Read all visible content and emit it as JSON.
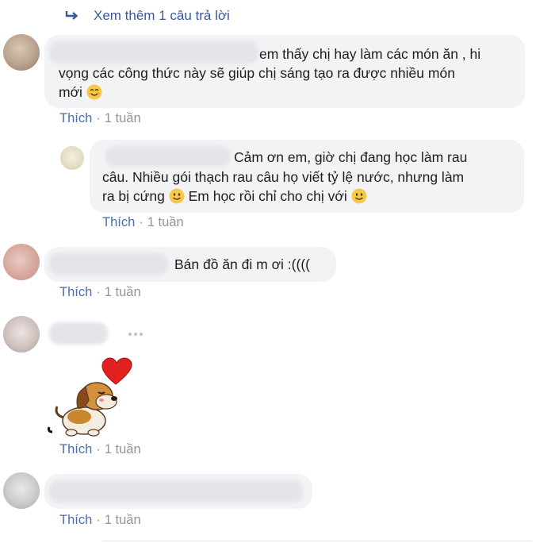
{
  "more_replies": {
    "label": "Xem thêm 1 câu trả lời"
  },
  "comments": [
    {
      "text_line1": "em thấy chị hay làm các món ăn , hi",
      "text_line2": "vọng các công thức này sẽ giúp chị sáng tạo ra được nhiều món",
      "text_line3": "mới",
      "like": "Thích",
      "sep": "·",
      "time": "1 tuần"
    },
    {
      "text_line1": "Cảm ơn em, giờ chị đang học làm rau",
      "text_line2": "câu. Nhiều gói thạch rau câu họ viết tỷ lệ nước, nhưng làm",
      "text_line3": "ra bị cứng",
      "text_line3b": "Em học rồi chỉ cho chị với",
      "like": "Thích",
      "sep": "·",
      "time": "1 tuần"
    },
    {
      "text_line1": "Bán đồ ăn đi m ơi :((((",
      "like": "Thích",
      "sep": "·",
      "time": "1 tuần"
    },
    {
      "like": "Thích",
      "sep": "·",
      "time": "1 tuần"
    },
    {
      "like": "Thích",
      "sep": "·",
      "time": "1 tuần"
    }
  ],
  "icons": [
    "reply-arrow-icon",
    "smiling-face-icon",
    "slightly-smiling-face-icon",
    "more-dots-icon",
    "puppy-heart-sticker"
  ],
  "colors": {
    "link": "#385898",
    "like": "#4b6ea8",
    "meta": "#90949c",
    "bubble": "#f2f3f5"
  }
}
